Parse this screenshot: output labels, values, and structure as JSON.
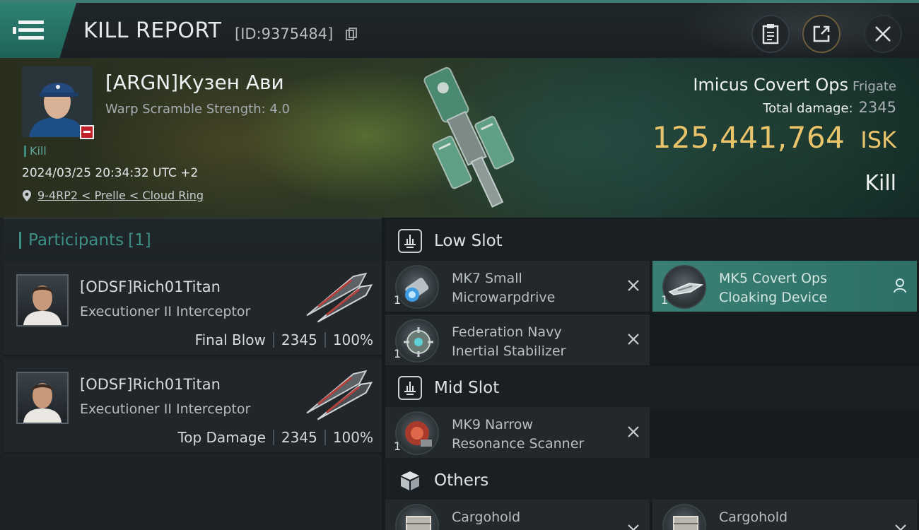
{
  "header": {
    "title": "KILL REPORT",
    "report_id": "[ID:9375484]",
    "icons": [
      "menu-icon",
      "copy-icon",
      "clipboard-icon",
      "share-icon",
      "close-icon"
    ]
  },
  "victim": {
    "name": "[ARGN]Кузен Ави",
    "warp_scramble": "Warp Scramble Strength: 4.0",
    "tag": "Kill",
    "timestamp": "2024/03/25 20:34:32 UTC +2",
    "location": "9-4RP2 < Prelle < Cloud Ring"
  },
  "ship": {
    "name": "Imicus Covert Ops",
    "class": "Frigate",
    "total_damage_label": "Total damage:",
    "total_damage": "2345",
    "isk_value": "125,441,764",
    "isk_unit": "ISK",
    "outcome": "Kill"
  },
  "participants": {
    "label": "Participants",
    "count": "[1]",
    "items": [
      {
        "name": "[ODSF]Rich01Titan",
        "ship": "Executioner II Interceptor",
        "role": "Final Blow",
        "damage": "2345",
        "percent": "100%"
      },
      {
        "name": "[ODSF]Rich01Titan",
        "ship": "Executioner II Interceptor",
        "role": "Top Damage",
        "damage": "2345",
        "percent": "100%"
      }
    ]
  },
  "fittings": {
    "low_slot": {
      "label": "Low Slot",
      "modules": [
        {
          "qty": "1",
          "line1": "MK7 Small",
          "line2": "Microwarpdrive",
          "status": "destroyed"
        },
        {
          "qty": "1",
          "line1": "MK5 Covert Ops",
          "line2": "Cloaking Device",
          "status": "dropped"
        },
        {
          "qty": "1",
          "line1": "Federation Navy",
          "line2": "Inertial Stabilizer",
          "status": "destroyed"
        }
      ]
    },
    "mid_slot": {
      "label": "Mid Slot",
      "modules": [
        {
          "qty": "1",
          "line1": "MK9 Narrow",
          "line2": "Resonance Scanner",
          "status": "destroyed"
        }
      ]
    },
    "others": {
      "label": "Others",
      "modules": [
        {
          "line1": "Cargohold",
          "status": "destroyed"
        },
        {
          "line1": "Cargohold",
          "status": "destroyed"
        }
      ]
    }
  },
  "colors": {
    "accent_teal": "#3e8f86",
    "isk_gold": "#e9c46a",
    "destroyed_badge": "#c0202a"
  }
}
